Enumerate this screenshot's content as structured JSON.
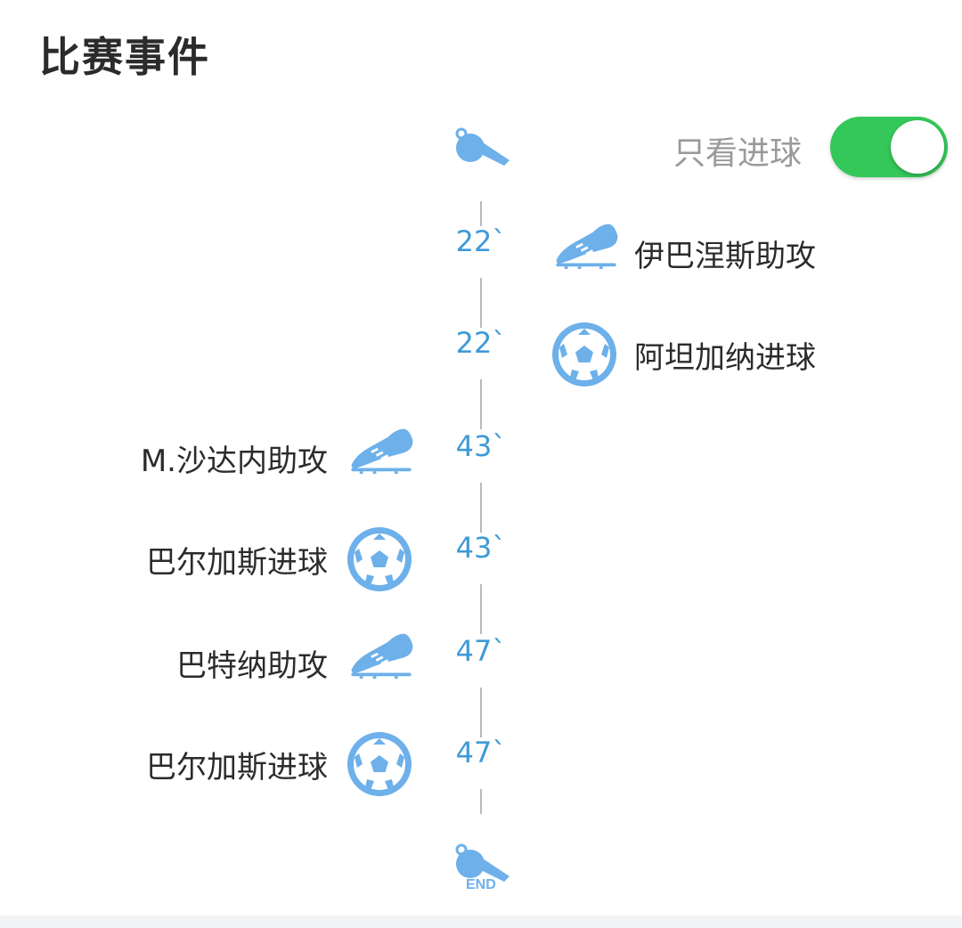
{
  "header": {
    "title": "比赛事件"
  },
  "filter": {
    "label": "只看进球",
    "toggle_on": true,
    "toggle_color": "#34c759"
  },
  "timeline": {
    "start_icon": "whistle-icon",
    "end_icon": "whistle-end-icon",
    "end_label": "END",
    "accent_color": "#3f9ad6",
    "events": [
      {
        "time": "22`",
        "side": "right",
        "type": "assist",
        "icon": "boot-icon",
        "text": "伊巴涅斯助攻"
      },
      {
        "time": "22`",
        "side": "right",
        "type": "goal",
        "icon": "football-icon",
        "text": "阿坦加纳进球"
      },
      {
        "time": "43`",
        "side": "left",
        "type": "assist",
        "icon": "boot-icon",
        "text": "M.沙达内助攻"
      },
      {
        "time": "43`",
        "side": "left",
        "type": "goal",
        "icon": "football-icon",
        "text": "巴尔加斯进球"
      },
      {
        "time": "47`",
        "side": "left",
        "type": "assist",
        "icon": "boot-icon",
        "text": "巴特纳助攻"
      },
      {
        "time": "47`",
        "side": "left",
        "type": "goal",
        "icon": "football-icon",
        "text": "巴尔加斯进球"
      }
    ]
  }
}
